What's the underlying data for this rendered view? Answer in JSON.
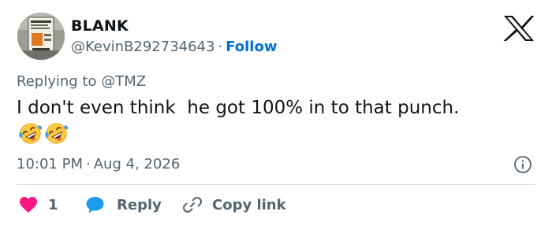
{
  "tweet": {
    "author": {
      "display_name": "BLANK",
      "handle": "@KevinB292734643",
      "separator": "·",
      "follow_label": "Follow",
      "avatar_icon": "avatar-photo-icon"
    },
    "brand_icon": "x-logo-icon",
    "reply_prefix": "Replying to ",
    "reply_to_handle": "@TMZ",
    "text": "I don't even think  he got 100% in to that punch.",
    "emojis": [
      "rolling-on-floor-laughing",
      "rolling-on-floor-laughing"
    ],
    "time": "10:01 PM",
    "date_separator": "·",
    "date": "Aug 4, 2026",
    "info_icon": "info-icon",
    "actions": {
      "like": {
        "icon": "heart-icon",
        "count": "1",
        "color": "#f91880"
      },
      "reply": {
        "icon": "chat-bubble-icon",
        "label": "Reply",
        "color": "#1d9bf0"
      },
      "copy_link": {
        "icon": "link-icon",
        "label": "Copy link"
      }
    },
    "colors": {
      "text_primary": "#0f1419",
      "text_secondary": "#536471",
      "accent_blue": "#006fd6",
      "divider": "#cfd9de"
    }
  }
}
